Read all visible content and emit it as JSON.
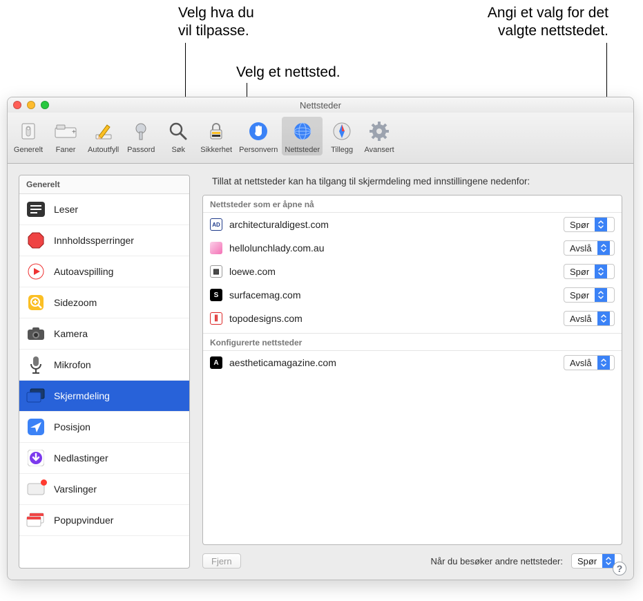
{
  "callouts": {
    "left": "Velg hva du\nvil tilpasse.",
    "middle": "Velg et nettsted.",
    "right": "Angi et valg for det\nvalgte nettstedet."
  },
  "window": {
    "title": "Nettsteder"
  },
  "toolbar": [
    {
      "id": "general",
      "label": "Generelt"
    },
    {
      "id": "tabs",
      "label": "Faner"
    },
    {
      "id": "autofill",
      "label": "Autoutfyll"
    },
    {
      "id": "passwords",
      "label": "Passord"
    },
    {
      "id": "search",
      "label": "Søk"
    },
    {
      "id": "security",
      "label": "Sikkerhet"
    },
    {
      "id": "privacy",
      "label": "Personvern"
    },
    {
      "id": "websites",
      "label": "Nettsteder"
    },
    {
      "id": "extensions",
      "label": "Tillegg"
    },
    {
      "id": "advanced",
      "label": "Avansert"
    }
  ],
  "sidebar": {
    "header": "Generelt",
    "items": [
      {
        "id": "reader",
        "label": "Leser"
      },
      {
        "id": "blockers",
        "label": "Innholdssperringer"
      },
      {
        "id": "autoplay",
        "label": "Autoavspilling"
      },
      {
        "id": "zoom",
        "label": "Sidezoom"
      },
      {
        "id": "camera",
        "label": "Kamera"
      },
      {
        "id": "mic",
        "label": "Mikrofon"
      },
      {
        "id": "screenshare",
        "label": "Skjermdeling"
      },
      {
        "id": "location",
        "label": "Posisjon"
      },
      {
        "id": "downloads",
        "label": "Nedlastinger"
      },
      {
        "id": "notifications",
        "label": "Varslinger"
      },
      {
        "id": "popups",
        "label": "Popupvinduer"
      }
    ],
    "selected": "screenshare"
  },
  "main": {
    "title": "Tillat at nettsteder kan ha tilgang til skjermdeling med innstillingene nedenfor:",
    "open_header": "Nettsteder som er åpne nå",
    "configured_header": "Konfigurerte nettsteder",
    "open_sites": [
      {
        "name": "architecturaldigest.com",
        "value": "Spør",
        "fav": "AD",
        "favbg": "#fff",
        "favcolor": "#1e3a8a",
        "border": "#1e3a8a"
      },
      {
        "name": "hellolunchlady.com.au",
        "value": "Avslå",
        "fav": "",
        "favbg": "#f9a8d4"
      },
      {
        "name": "loewe.com",
        "value": "Spør",
        "fav": "▩",
        "favbg": "#fff",
        "favcolor": "#333",
        "border": "#999"
      },
      {
        "name": "surfacemag.com",
        "value": "Spør",
        "fav": "S",
        "favbg": "#000"
      },
      {
        "name": "topodesigns.com",
        "value": "Avslå",
        "fav": "⫴",
        "favbg": "#fff",
        "favcolor": "#dc2626",
        "border": "#dc2626"
      }
    ],
    "configured_sites": [
      {
        "name": "aestheticamagazine.com",
        "value": "Avslå",
        "fav": "A",
        "favbg": "#000"
      }
    ],
    "remove_label": "Fjern",
    "footer_label": "Når du besøker andre nettsteder:",
    "footer_value": "Spør"
  }
}
